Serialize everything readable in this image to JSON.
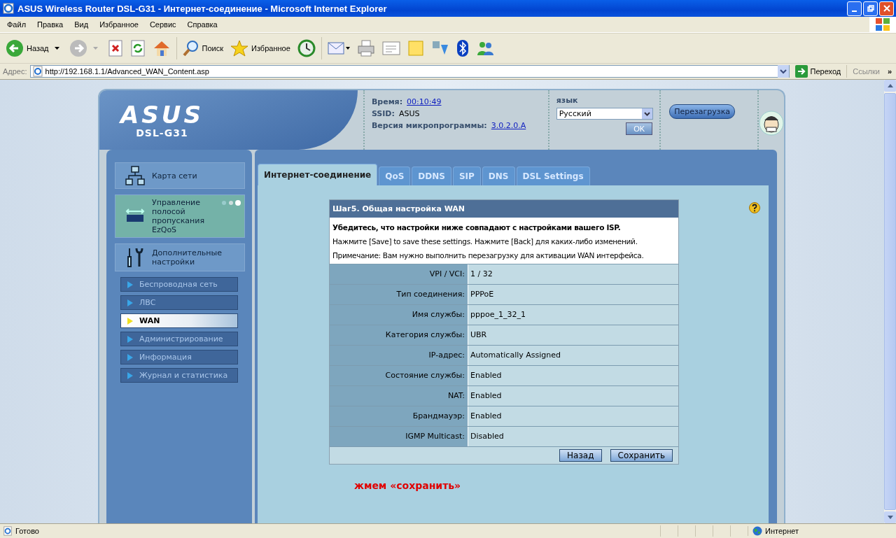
{
  "window": {
    "title": "ASUS Wireless Router DSL-G31 - Интернет-соединение - Microsoft Internet Explorer"
  },
  "menu": [
    "Файл",
    "Правка",
    "Вид",
    "Избранное",
    "Сервис",
    "Справка"
  ],
  "toolbar": {
    "back": "Назад",
    "search": "Поиск",
    "favorites": "Избранное"
  },
  "address_bar": {
    "label": "Адрес:",
    "url": "http://192.168.1.1/Advanced_WAN_Content.asp",
    "go": "Переход",
    "links": "Ссылки",
    "more": "»"
  },
  "router": {
    "logo": "ASUS",
    "model": "DSL-G31",
    "info": [
      {
        "label": "Время:",
        "value": "00:10:49",
        "link": true
      },
      {
        "label": "SSID:",
        "value": "ASUS",
        "link": false
      },
      {
        "label": "Версия микропрограммы:",
        "value": "3.0.2.0.A",
        "link": true
      }
    ],
    "language": {
      "label": "язык",
      "value": "Русский",
      "ok": "OK"
    },
    "reboot": "Перезагрузка"
  },
  "sidebar": {
    "items": [
      {
        "label": "Карта сети",
        "kind": "map",
        "highlighted": false
      },
      {
        "label": "Управление полосой пропускания EzQoS",
        "kind": "qos",
        "highlighted": true
      },
      {
        "label": "Дополнительные настройки",
        "kind": "tools",
        "highlighted": false
      }
    ],
    "subitems": [
      {
        "label": "Беспроводная сеть",
        "selected": false
      },
      {
        "label": "ЛВС",
        "selected": false
      },
      {
        "label": "WAN",
        "selected": true
      },
      {
        "label": "Администрирование",
        "selected": false
      },
      {
        "label": "Информация",
        "selected": false
      },
      {
        "label": "Журнал и статистика",
        "selected": false
      }
    ]
  },
  "tabs": [
    {
      "label": "Интернет-соединение",
      "selected": true
    },
    {
      "label": "QoS",
      "selected": false
    },
    {
      "label": "DDNS",
      "selected": false
    },
    {
      "label": "SIP",
      "selected": false
    },
    {
      "label": "DNS",
      "selected": false
    },
    {
      "label": "DSL Settings",
      "selected": false
    }
  ],
  "panel": {
    "title": "Шаг5. Общая настройка WAN",
    "notes": [
      {
        "text": "Убедитесь, что настройки ниже совпадают с настройками вашего ISP.",
        "bold": true
      },
      {
        "text": "Нажмите [Save] to save these settings. Нажмите [Back] для каких-либо изменений.",
        "bold": false
      },
      {
        "text": "Примечание: Вам нужно выполнить перезагрузку для активации WAN интерфейса.",
        "bold": false
      }
    ],
    "rows": [
      {
        "label": "VPI / VCI:",
        "value": "1 / 32"
      },
      {
        "label": "Тип соединения:",
        "value": "PPPoE"
      },
      {
        "label": "Имя службы:",
        "value": "pppoe_1_32_1"
      },
      {
        "label": "Категория службы:",
        "value": "UBR"
      },
      {
        "label": "IP-адрес:",
        "value": "Automatically Assigned"
      },
      {
        "label": "Состояние службы:",
        "value": "Enabled"
      },
      {
        "label": "NAT:",
        "value": "Enabled"
      },
      {
        "label": "Брандмауэр:",
        "value": "Enabled"
      },
      {
        "label": "IGMP Multicast:",
        "value": "Disabled"
      }
    ],
    "buttons": [
      "Назад",
      "Сохранить"
    ]
  },
  "annotation": "жмем «сохранить»",
  "status_bar": {
    "status": "Готово",
    "zone": "Интернет"
  }
}
